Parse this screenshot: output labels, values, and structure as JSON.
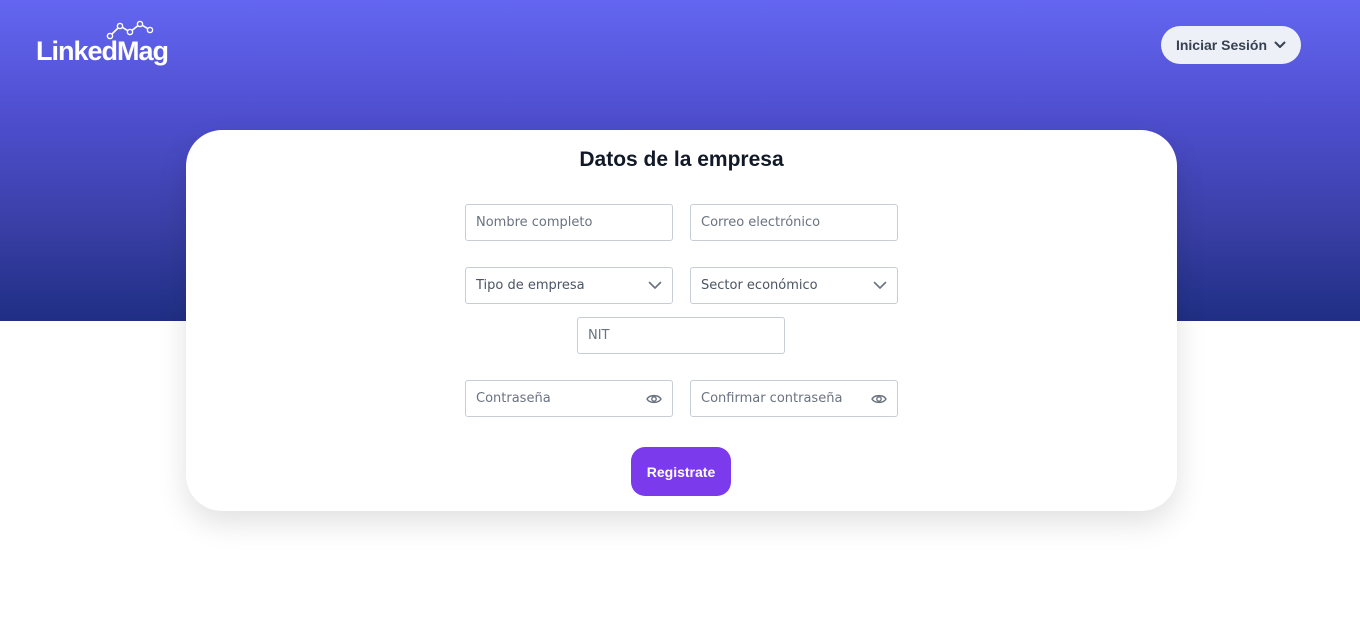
{
  "header": {
    "logo_text": "LinkedMag",
    "login_button_label": "Iniciar Sesión"
  },
  "form": {
    "title": "Datos de la empresa",
    "full_name": {
      "placeholder": "Nombre completo",
      "value": ""
    },
    "email": {
      "placeholder": "Correo electrónico",
      "value": ""
    },
    "company_type": {
      "selected": "Tipo de empresa"
    },
    "economic_sector": {
      "selected": "Sector económico"
    },
    "nit": {
      "placeholder": "NIT",
      "value": ""
    },
    "password": {
      "placeholder": "Contraseña",
      "value": ""
    },
    "confirm_password": {
      "placeholder": "Confirmar contraseña",
      "value": ""
    },
    "submit_label": "Registrate"
  },
  "icons": {
    "logo": "chart-line-icon",
    "login_dropdown": "chevron-down-icon",
    "select": "chevron-down-icon",
    "password_toggle": "eye-icon"
  },
  "colors": {
    "hero_top": "#6366f1",
    "hero_bottom": "#1f2f84",
    "accent": "#7c3aed",
    "login_button_bg": "#eef0f7"
  }
}
